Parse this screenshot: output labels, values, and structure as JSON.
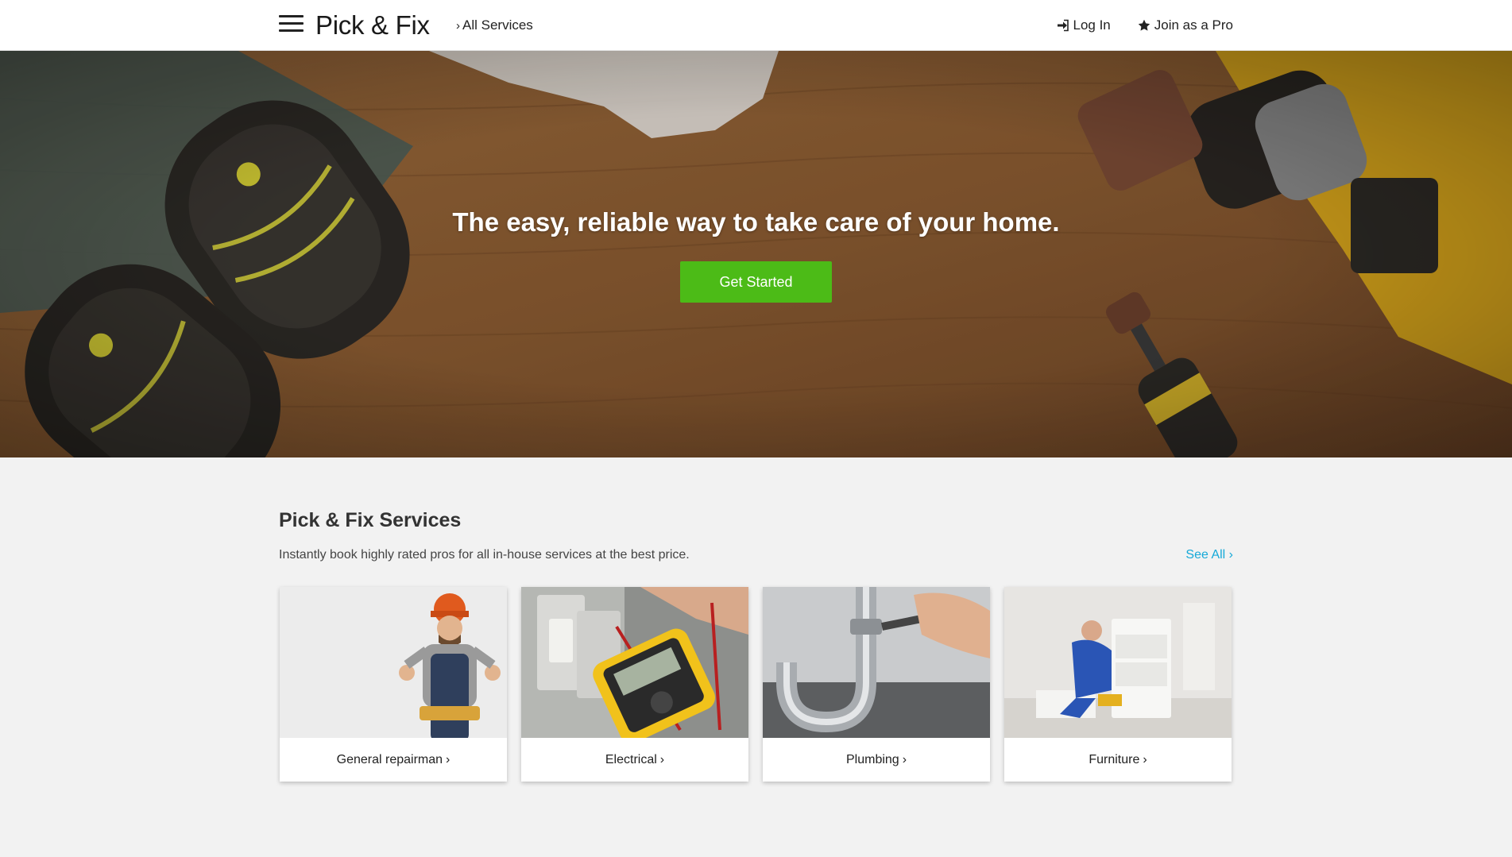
{
  "header": {
    "brand": "Pick & Fix",
    "all_services": "All Services",
    "login": "Log In",
    "join_pro": "Join as a Pro"
  },
  "hero": {
    "title": "The easy, reliable way to take care of your home.",
    "cta": "Get Started"
  },
  "services": {
    "title": "Pick & Fix Services",
    "subtitle": "Instantly book highly rated pros for all in-house services at the best price.",
    "see_all": "See All",
    "items": [
      {
        "label": "General repairman"
      },
      {
        "label": "Electrical"
      },
      {
        "label": "Plumbing"
      },
      {
        "label": "Furniture"
      }
    ]
  },
  "colors": {
    "accent_green": "#4cbb17",
    "link_blue": "#16a9d8"
  },
  "icons": [
    "menu-icon",
    "chevron-right-icon",
    "sign-in-icon",
    "star-icon"
  ]
}
